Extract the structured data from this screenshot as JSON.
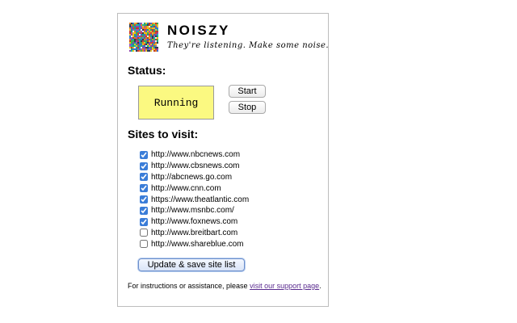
{
  "app": {
    "title": "NOISZY",
    "tagline": "They're listening. Make some noise.",
    "logo_icon": "noise-pattern-logo"
  },
  "status": {
    "heading": "Status:",
    "value": "Running",
    "box_color": "#fbf981",
    "start_label": "Start",
    "stop_label": "Stop"
  },
  "sites": {
    "heading": "Sites to visit:",
    "items": [
      {
        "url": "http://www.nbcnews.com",
        "checked": true
      },
      {
        "url": "http://www.cbsnews.com",
        "checked": true
      },
      {
        "url": "http://abcnews.go.com",
        "checked": true
      },
      {
        "url": "http://www.cnn.com",
        "checked": true
      },
      {
        "url": "https://www.theatlantic.com",
        "checked": true
      },
      {
        "url": "http://www.msnbc.com/",
        "checked": true
      },
      {
        "url": "http://www.foxnews.com",
        "checked": true
      },
      {
        "url": "http://www.breitbart.com",
        "checked": false
      },
      {
        "url": "http://www.shareblue.com",
        "checked": false
      }
    ],
    "update_label": "Update & save site list"
  },
  "footer": {
    "text": "For instructions or assistance, please ",
    "link_text": "visit our support page",
    "suffix": ".",
    "link_color": "#5a2b8f"
  }
}
